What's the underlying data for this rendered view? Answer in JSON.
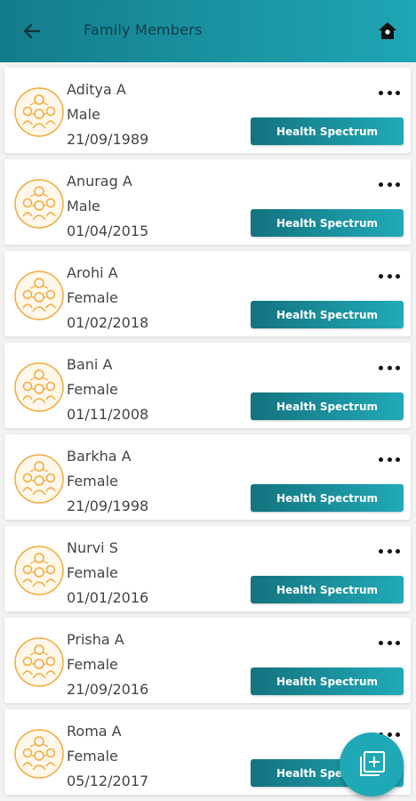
{
  "header": {
    "title": "Family Members",
    "back_icon": "arrow-left-icon",
    "home_icon": "home-icon"
  },
  "members": [
    {
      "name": "Aditya A",
      "gender": "Male",
      "dob": "21/09/1989",
      "action_label": "Health Spectrum"
    },
    {
      "name": "Anurag A",
      "gender": "Male",
      "dob": "01/04/2015",
      "action_label": "Health Spectrum"
    },
    {
      "name": "Arohi A",
      "gender": "Female",
      "dob": "01/02/2018",
      "action_label": "Health Spectrum"
    },
    {
      "name": "Bani A",
      "gender": "Female",
      "dob": "01/11/2008",
      "action_label": "Health Spectrum"
    },
    {
      "name": "Barkha A",
      "gender": "Female",
      "dob": "21/09/1998",
      "action_label": "Health Spectrum"
    },
    {
      "name": "Nurvi S",
      "gender": "Female",
      "dob": "01/01/2016",
      "action_label": "Health Spectrum"
    },
    {
      "name": "Prisha A",
      "gender": "Female",
      "dob": "21/09/2016",
      "action_label": "Health Spectrum"
    },
    {
      "name": "Roma A",
      "gender": "Female",
      "dob": "05/12/2017",
      "action_label": "Health Spectrum"
    }
  ],
  "fab": {
    "icon": "add-to-list-icon"
  },
  "colors": {
    "header_start": "#147c8a",
    "header_end": "#1fa6b5",
    "button_start": "#13737f",
    "button_end": "#22aab8",
    "avatar_accent": "#f2a93b",
    "fab": "#1fa9b6"
  }
}
